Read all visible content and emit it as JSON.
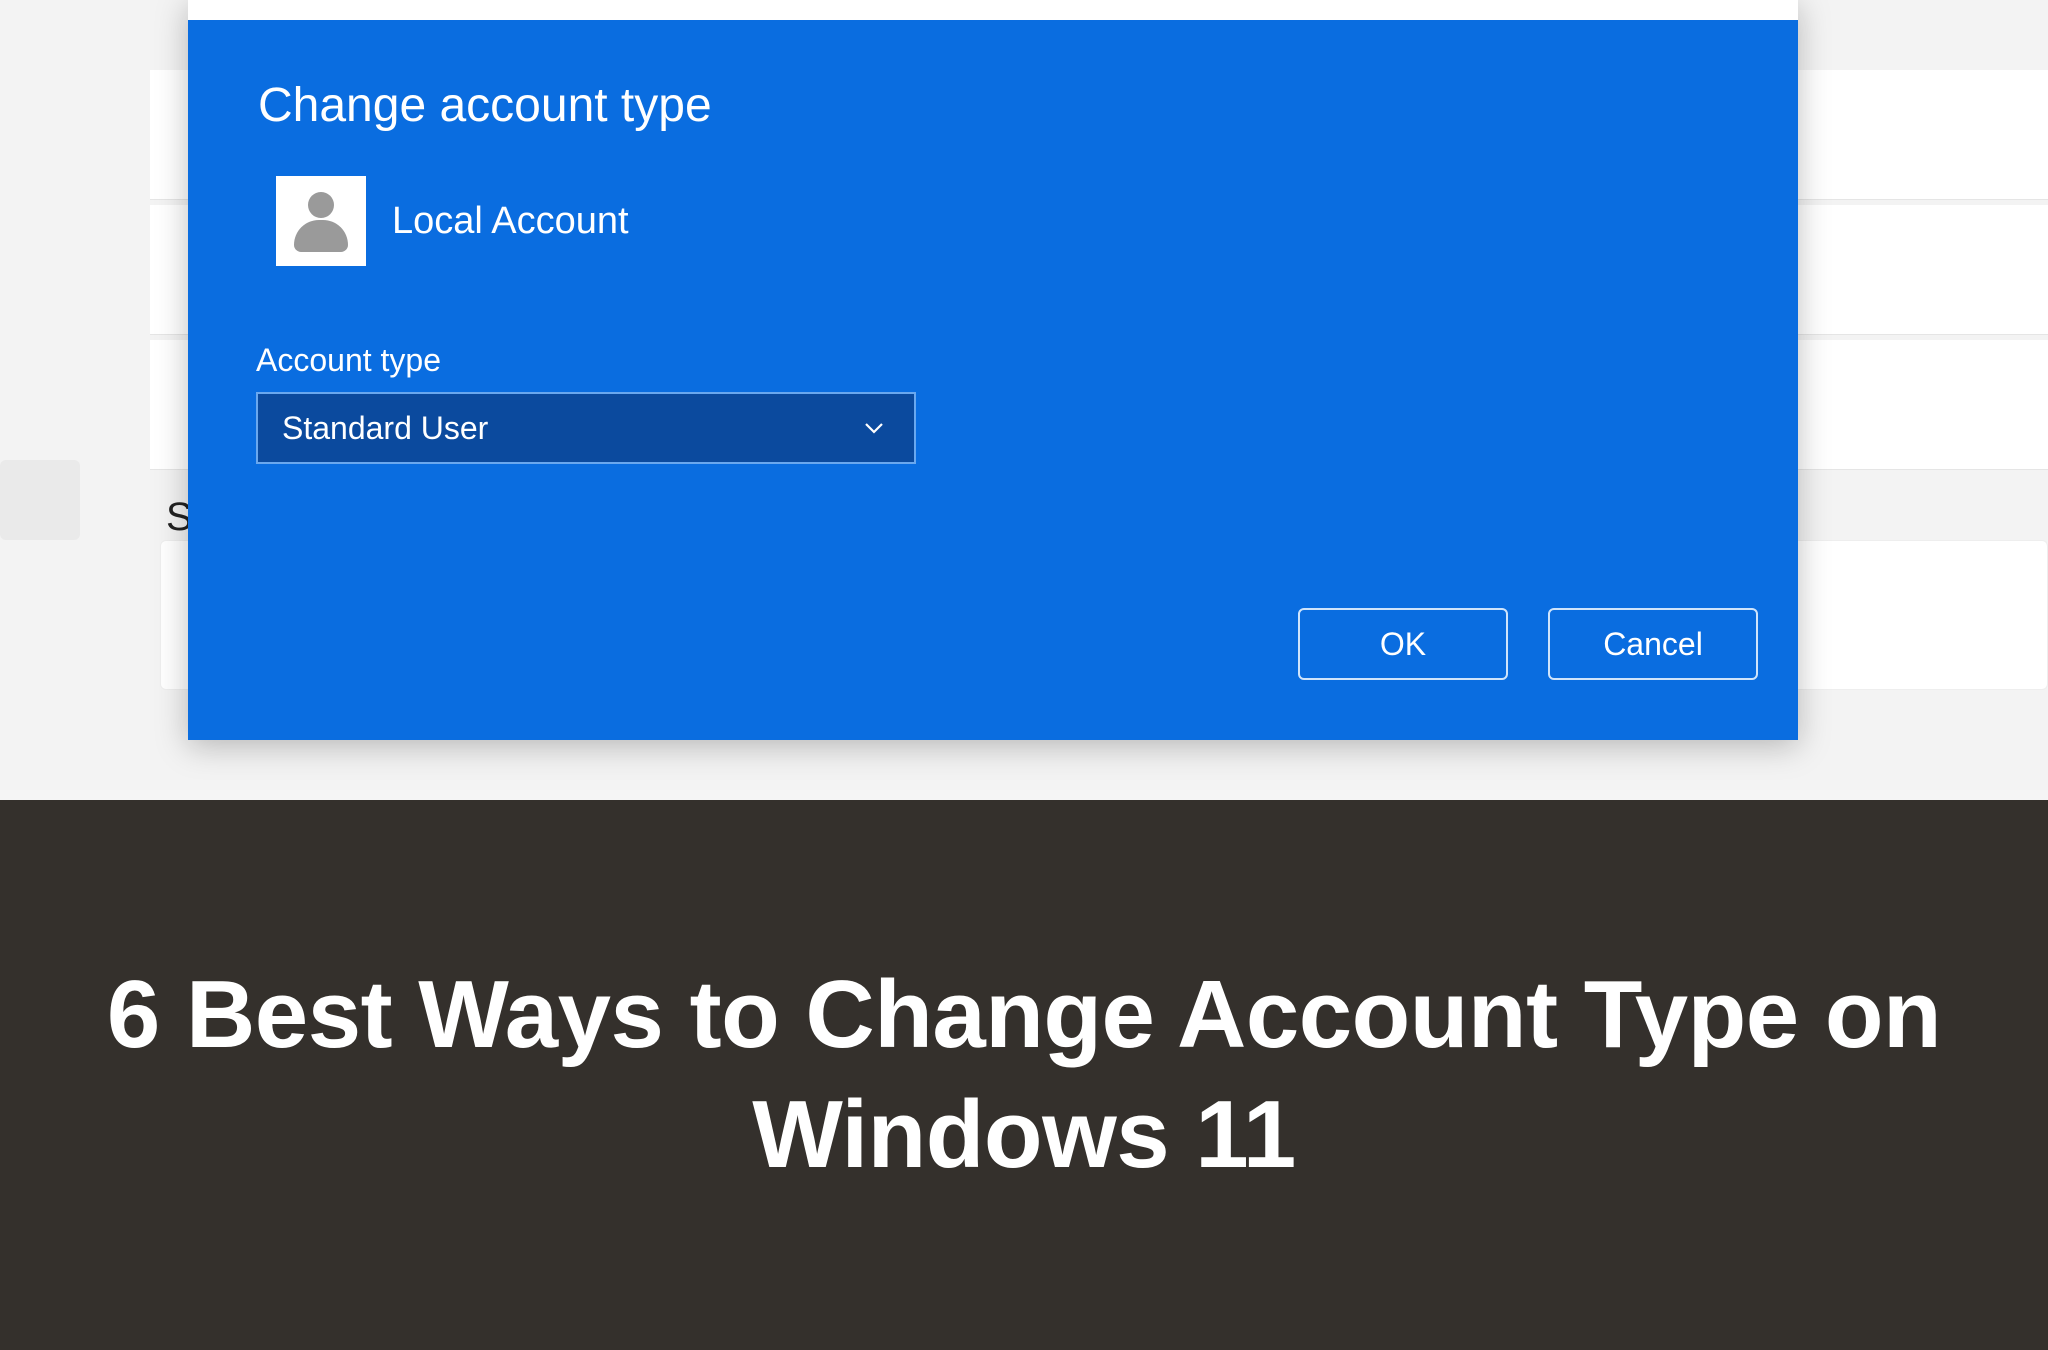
{
  "dialog": {
    "heading": "Change account type",
    "account_name": "Local Account",
    "field_label": "Account type",
    "select_value": "Standard User",
    "ok_label": "OK",
    "cancel_label": "Cancel"
  },
  "background": {
    "partial_text": "S"
  },
  "article": {
    "headline": "6 Best Ways to Change Account Type on Windows 11"
  }
}
